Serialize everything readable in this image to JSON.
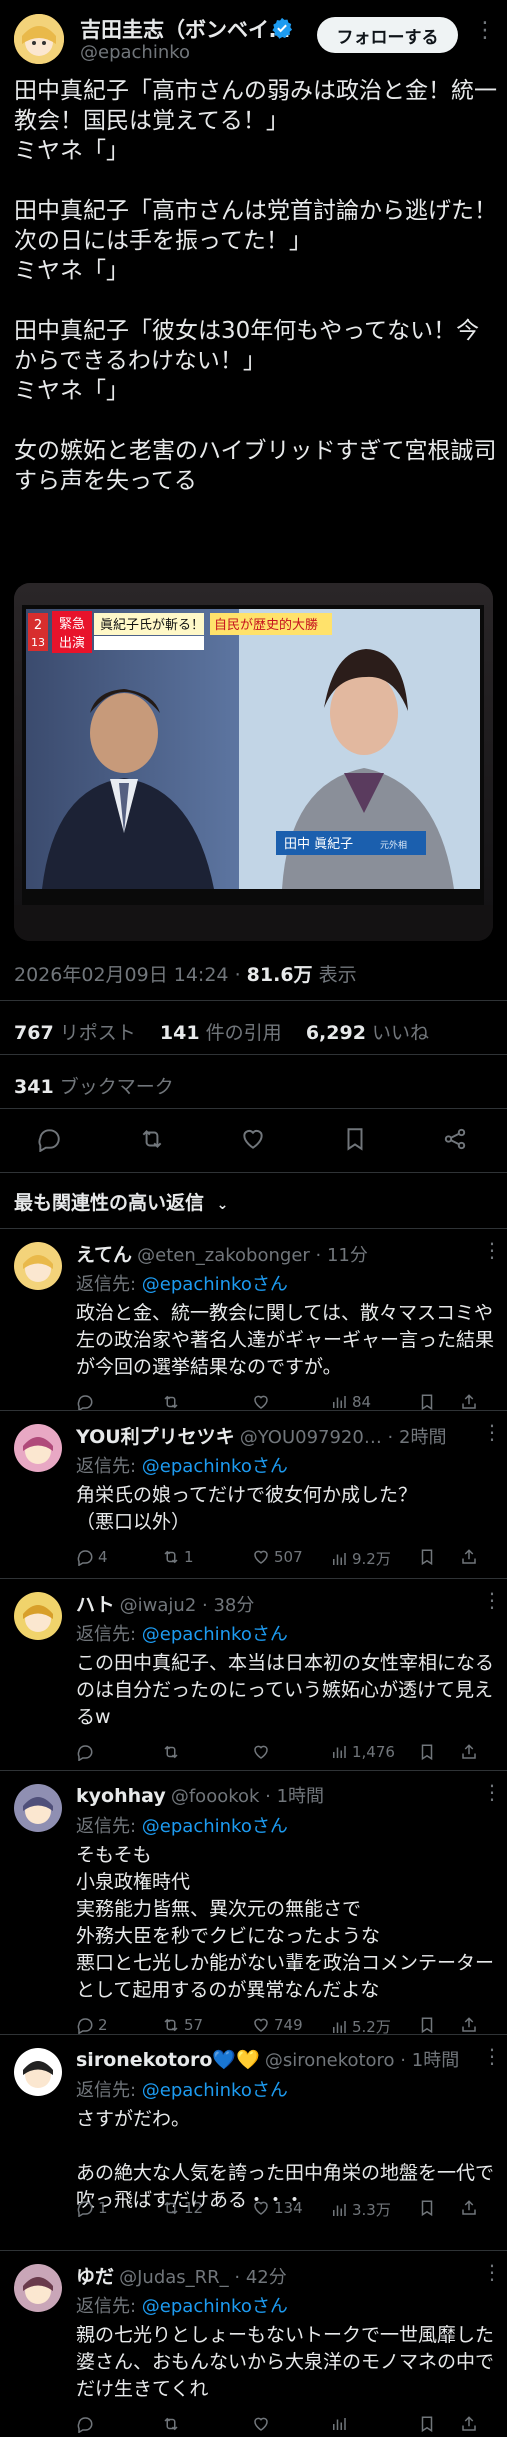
{
  "author": {
    "name": "吉田圭志（ボンベイ…",
    "handle": "@epachinko",
    "follow_label": "フォローする"
  },
  "tweet": {
    "text": "田中真紀子「高市さんの弱みは政治と金！統一教会！国民は覚えてる！」\nミヤネ「」\n\n田中真紀子「高市さんは党首討論から逃げた！次の日には手を振ってた！」\nミヤネ「」\n\n田中真紀子「彼女は30年何もやってない！今からできるわけない！」\nミヤネ「」\n\n女の嫉妬と老害のハイブリッドすぎて宮根誠司すら声を失ってる",
    "timestamp": "2026年02月09日 14:24",
    "views": "81.6万",
    "views_label": "表示",
    "image": {
      "channel": "2",
      "channel_sub": "13",
      "badge_top": "緊急",
      "badge_bottom": "出演",
      "headline": "眞紀子氏が斬る！",
      "headline_right": "自民が歴史的大勝",
      "caption_name": "田中 眞紀子",
      "caption_role": "元外相"
    }
  },
  "stats": {
    "reposts": "767",
    "reposts_label": "リポスト",
    "quotes": "141",
    "quotes_label": "件の引用",
    "likes": "6,292",
    "likes_label": "いいね",
    "bookmarks": "341",
    "bookmarks_label": "ブックマーク"
  },
  "sort_label": "最も関連性の高い返信",
  "replies": [
    {
      "name": "えてん",
      "handle": "@eten_zakobonger · 11分",
      "to_prefix": "返信先: ",
      "to": "@epachinkoさん",
      "text": "政治と金、統一教会に関しては、散々マスコミや左の政治家や著名人達がギャーギャー言った結果が今回の選挙結果なのですが。",
      "replies": "",
      "reposts": "",
      "likes": "",
      "views": "84"
    },
    {
      "name": "YOU利プリセツキ",
      "handle": "@YOU097920… · 2時間",
      "to_prefix": "返信先: ",
      "to": "@epachinkoさん",
      "text": "角栄氏の娘ってだけで彼女何か成した？\n（悪口以外）",
      "replies": "4",
      "reposts": "1",
      "likes": "507",
      "views": "9.2万"
    },
    {
      "name": "ハト",
      "handle": "@iwaju2 · 38分",
      "to_prefix": "返信先: ",
      "to": "@epachinkoさん",
      "text": "この田中真紀子、本当は日本初の女性宰相になるのは自分だったのにっていう嫉妬心が透けて見えるw",
      "replies": "",
      "reposts": "",
      "likes": "",
      "views": "1,476"
    },
    {
      "name": "kyohhay",
      "handle": "@foookok · 1時間",
      "to_prefix": "返信先: ",
      "to": "@epachinkoさん",
      "text": "そもそも\n小泉政権時代\n実務能力皆無、異次元の無能さで\n外務大臣を秒でクビになったような\n悪口と七光しか能がない輩を政治コメンテーターとして起用するのが異常なんだよな",
      "replies": "2",
      "reposts": "57",
      "likes": "749",
      "views": "5.2万"
    },
    {
      "name": "sironekotoro💙💛",
      "handle": "@sironekotoro · 1時間",
      "to_prefix": "返信先: ",
      "to": "@epachinkoさん",
      "text": "さすがだわ。\n\nあの絶大な人気を誇った田中角栄の地盤を一代で吹っ飛ばすだけある・・・",
      "replies": "1",
      "reposts": "12",
      "likes": "134",
      "views": "3.3万"
    },
    {
      "name": "ゆだ",
      "handle": "@Judas_RR_ · 42分",
      "to_prefix": "返信先: ",
      "to": "@epachinkoさん",
      "text": "親の七光りとしょーもないトークで一世風靡した婆さん、おもんないから大泉洋のモノマネの中でだけ生きてくれ",
      "replies": "",
      "reposts": "",
      "likes": "",
      "views": ""
    }
  ],
  "colors": {
    "accent": "#1d9bf0",
    "verified": "#1d9bf0",
    "muted": "#71767b",
    "border": "#2f3336"
  }
}
